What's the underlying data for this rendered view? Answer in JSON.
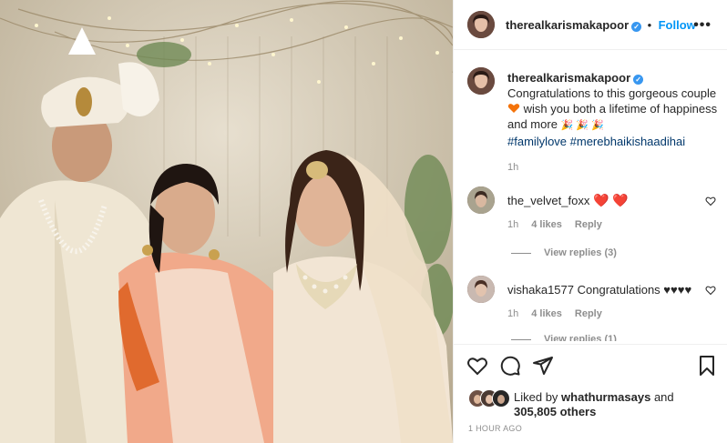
{
  "post": {
    "username": "therealkarismakapoor",
    "verified_badge": "✓",
    "separator": "•",
    "follow_label": "Follow",
    "more_icon": "more-horizontal-icon"
  },
  "caption": {
    "username": "therealkarismakapoor",
    "line1": "Congratulations to this gorgeous couple",
    "line2": "wish you both a lifetime of happiness",
    "line3": "and more",
    "hashtags": "#familylove #merebhaikishaadihai",
    "time": "1h"
  },
  "comments": [
    {
      "username": "the_velvet_foxx",
      "text": "",
      "time": "1h",
      "likes": "4 likes",
      "reply_label": "Reply",
      "view_replies": "View replies (3)"
    },
    {
      "username": "vishaka1577",
      "text": "Congratulations ♥♥♥♥",
      "time": "1h",
      "likes": "4 likes",
      "reply_label": "Reply",
      "view_replies": "View replies (1)"
    }
  ],
  "likes": {
    "prefix": "Liked by",
    "user": "whathurmasays",
    "and": "and",
    "count": "305,805 others"
  },
  "timestamp": "1 HOUR AGO",
  "colors": {
    "accent": "#0095f6",
    "heart": "#ed4956",
    "secondary_text": "#8e8e8e"
  }
}
